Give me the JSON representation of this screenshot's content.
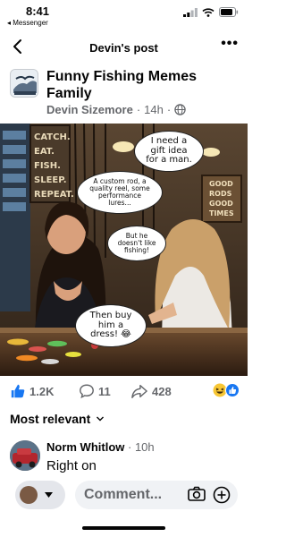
{
  "status_bar": {
    "time": "8:41",
    "back_app": "◂ Messenger"
  },
  "nav": {
    "title": "Devin's post"
  },
  "post": {
    "group_name": "Funny Fishing Memes Family",
    "author": "Devin Sizemore",
    "time": "14h",
    "separator": "·"
  },
  "image": {
    "bubbles": {
      "man": "I need a gift idea for a man.",
      "rod": "A custom rod, a quality reel, some performance lures...",
      "fishing": "But he doesn't like fishing!",
      "dress": "Then buy him a dress! 😂"
    },
    "signs": {
      "left": [
        "CATCH.",
        "EAT.",
        "FISH.",
        "SLEEP.",
        "REPEAT."
      ],
      "right": [
        "GOOD",
        "RODS",
        "GOOD",
        "TIMES"
      ]
    }
  },
  "reactions": {
    "likes": "1.2K",
    "comments": "11",
    "shares": "428"
  },
  "sort": {
    "label": "Most relevant"
  },
  "comment": {
    "name": "Norm Whitlow",
    "time": "· 10h",
    "text": "Right on"
  },
  "composer": {
    "placeholder": "Comment..."
  }
}
